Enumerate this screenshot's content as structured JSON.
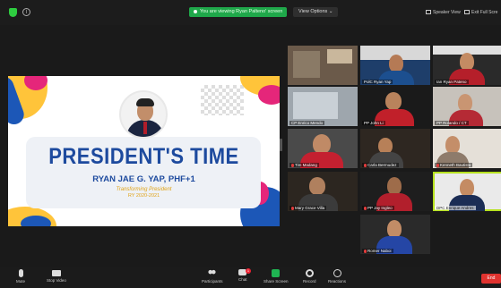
{
  "topbar": {
    "share_banner": "You are viewing Ryan Palteno' screen",
    "view_options": "View Options ⌄",
    "speaker_view": "Speaker View",
    "exit_full_screen": "Exit Full Scre"
  },
  "slide": {
    "title": "PRESIDENT'S TIME",
    "name": "RYAN JAE G. YAP, PHF+1",
    "subtitle": "Transforming President",
    "year": "RY 2020-2021"
  },
  "gallery": [
    {
      "label": ""
    },
    {
      "label": ""
    },
    {
      "label": "PolC Ryan Yap"
    },
    {
      "label": "Ian Ryan Pateno"
    },
    {
      "label": "CP Enrico Mendo"
    },
    {
      "label": "PP John Li"
    },
    {
      "label": "PP Rolando / CT"
    },
    {
      "label": "Tim Madang"
    },
    {
      "label": "Carla Bermudez"
    },
    {
      "label": "Kenneth Bautista"
    },
    {
      "label": "Mary Grace Villa"
    },
    {
      "label": "PP Jay Ingleo"
    },
    {
      "label": "DPC Enrique Andres"
    },
    {
      "label": "Romer Naboi"
    }
  ],
  "toolbar": {
    "mute": "Mute",
    "video": "Stop Video",
    "participants": "Participants",
    "participants_count": "21",
    "chat": "Chat",
    "chat_badge": "1",
    "share": "Share Screen",
    "record": "Record",
    "reactions": "Reactions",
    "end": "End"
  }
}
